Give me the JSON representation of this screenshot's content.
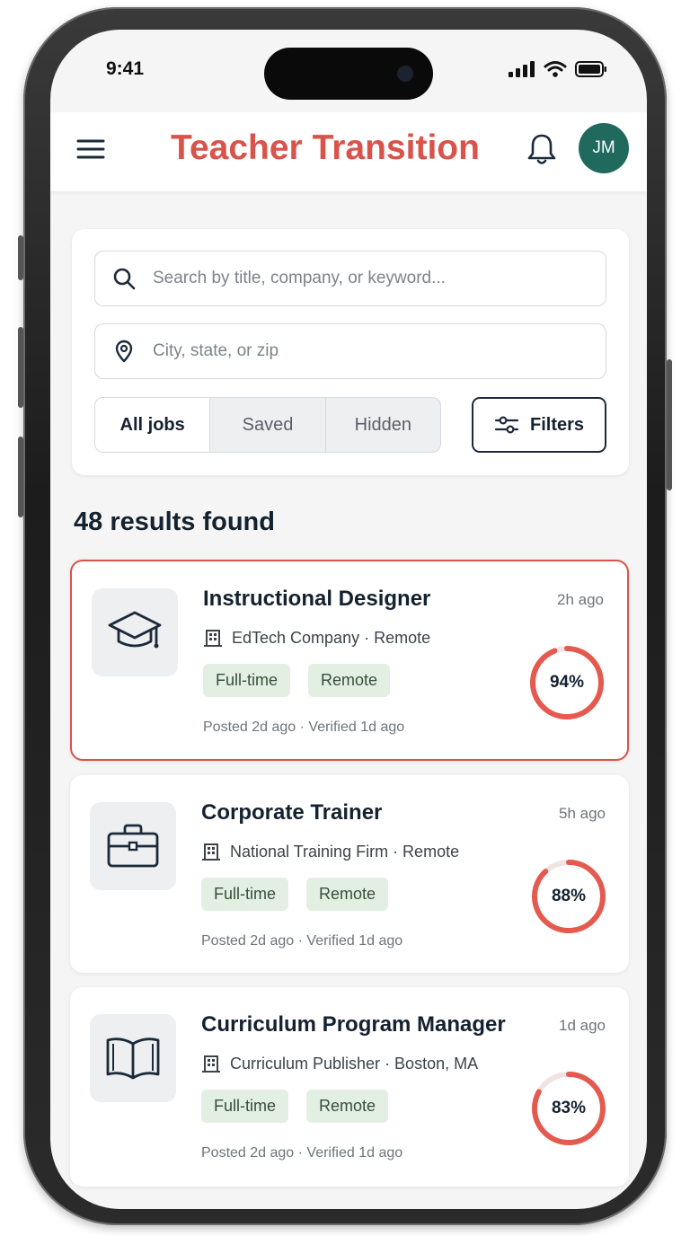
{
  "status_bar": {
    "time": "9:41"
  },
  "header": {
    "title": "Teacher Transition",
    "avatar_initials": "JM"
  },
  "search": {
    "keyword_placeholder": "Search by title, company, or keyword...",
    "location_placeholder": "City, state, or zip"
  },
  "tabs": [
    {
      "label": "All jobs",
      "active": true
    },
    {
      "label": "Saved",
      "active": false
    },
    {
      "label": "Hidden",
      "active": false
    }
  ],
  "filters_label": "Filters",
  "results_label": "48 results found",
  "jobs": [
    {
      "title": "Instructional Designer",
      "time": "2h ago",
      "company": "EdTech Company · Remote",
      "tags": [
        "Full-time",
        "Remote"
      ],
      "meta": "Posted 2d ago · Verified 1d ago",
      "match": 94,
      "match_label": "94%",
      "icon": "graduation-cap-icon",
      "highlighted": true
    },
    {
      "title": "Corporate Trainer",
      "time": "5h ago",
      "company": "National Training Firm · Remote",
      "tags": [
        "Full-time",
        "Remote"
      ],
      "meta": "Posted 2d ago · Verified 1d ago",
      "match": 88,
      "match_label": "88%",
      "icon": "briefcase-icon",
      "highlighted": false
    },
    {
      "title": "Curriculum Program Manager",
      "time": "1d ago",
      "company": "Curriculum Publisher · Boston, MA",
      "tags": [
        "Full-time",
        "Remote"
      ],
      "meta": "Posted 2d ago · Verified 1d ago",
      "match": 83,
      "match_label": "83%",
      "icon": "open-book-icon",
      "highlighted": false
    }
  ],
  "colors": {
    "accent": "#d9534b",
    "navy": "#14212f",
    "avatar": "#1f6a5c",
    "tag_bg": "#e3efe2"
  }
}
